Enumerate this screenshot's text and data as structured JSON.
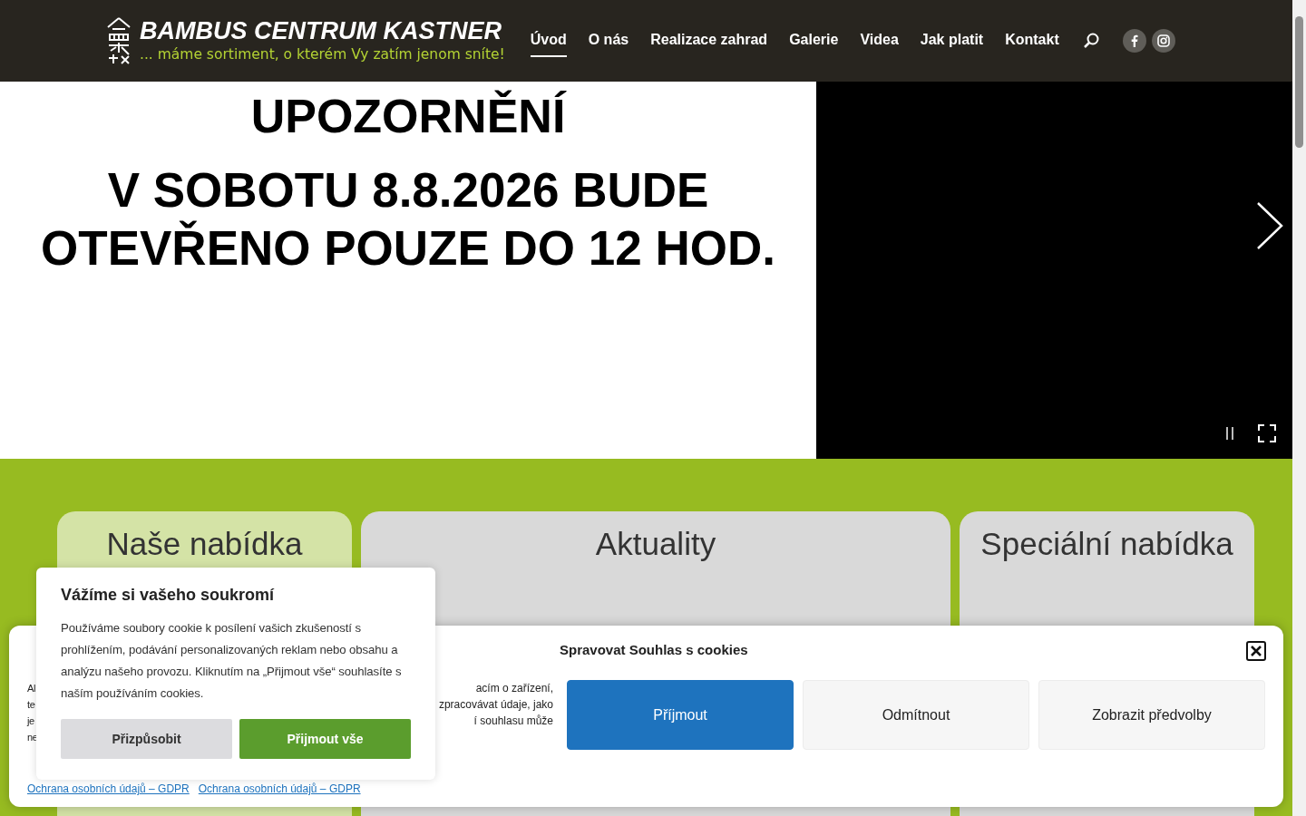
{
  "header": {
    "title": "BAMBUS CENTRUM KASTNER",
    "tagline": "... máme sortiment, o kterém Vy zatím jenom sníte!",
    "nav": [
      {
        "label": "Úvod",
        "selected": true
      },
      {
        "label": "O nás",
        "selected": false
      },
      {
        "label": "Realizace zahrad",
        "selected": false
      },
      {
        "label": "Galerie",
        "selected": false
      },
      {
        "label": "Videa",
        "selected": false
      },
      {
        "label": "Jak platit",
        "selected": false
      },
      {
        "label": "Kontakt",
        "selected": false
      }
    ]
  },
  "slider": {
    "heading": "UPOZORNĚNÍ",
    "lines": [
      "V SOBOTU 8.8.2026 BUDE",
      "OTEVŘENO POUZE DO 12 HOD."
    ],
    "paused": false
  },
  "cards": [
    {
      "title": "Naše nabídka",
      "kind": "green"
    },
    {
      "title": "Aktuality",
      "kind": "gray"
    },
    {
      "title": "Speciální nabídka",
      "kind": "gray"
    }
  ],
  "consent_banner": {
    "title": "Spravovat Souhlas s cookies",
    "text_lines": [
      {
        "left": "Al",
        "right": "acím o zařízení,"
      },
      {
        "left": "te",
        "right": "zpracovávat údaje, jako"
      },
      {
        "left": "je",
        "right": "í souhlasu může"
      },
      {
        "left": "ne"
      }
    ],
    "links": [
      "Ochrana osobních údajů – GDPR",
      "Ochrana osobních údajů – GDPR"
    ],
    "buttons": [
      {
        "label": "Příjmout",
        "kind": "primary"
      },
      {
        "label": "Odmítnout",
        "kind": "secondary"
      },
      {
        "label": "Zobrazit předvolby",
        "kind": "secondary"
      }
    ]
  },
  "privacy_popup": {
    "title": "Vážíme si vašeho soukromí",
    "text": "Používáme soubory cookie k posílení vašich zkušeností s prohlížením, podávání personalizovaných reklam nebo obsahu a analýzu našeho provozu. Kliknutím na „Přijmout vše“ souhlasíte s naším používáním cookies.",
    "buttons": [
      {
        "label": "Přizpůsobit",
        "kind": "secondary"
      },
      {
        "label": "Přijmout vše",
        "kind": "primary"
      }
    ]
  }
}
